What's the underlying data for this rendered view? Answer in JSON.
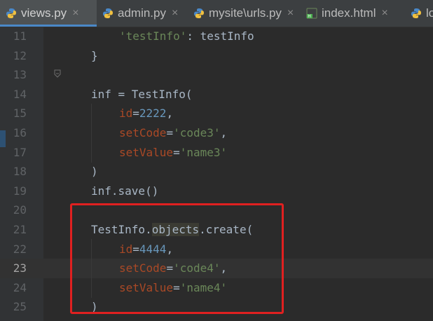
{
  "tabs": [
    {
      "label": "views.py",
      "close": "×"
    },
    {
      "label": "admin.py",
      "close": "×"
    },
    {
      "label": "mysite\\urls.py",
      "close": "×"
    },
    {
      "label": "index.html",
      "close": "×"
    },
    {
      "label": "lo"
    }
  ],
  "lines": [
    {
      "n": "11",
      "seg": [
        "'testInfo'",
        ": testInfo"
      ]
    },
    {
      "n": "12",
      "seg": [
        "}"
      ]
    },
    {
      "n": "13",
      "seg": []
    },
    {
      "n": "14",
      "seg": [
        "inf = TestInfo("
      ]
    },
    {
      "n": "15",
      "seg": [
        "id",
        "=",
        "2222",
        ","
      ]
    },
    {
      "n": "16",
      "seg": [
        "setCode",
        "=",
        "'code3'",
        ","
      ]
    },
    {
      "n": "17",
      "seg": [
        "setValue",
        "=",
        "'name3'"
      ]
    },
    {
      "n": "18",
      "seg": [
        ")"
      ]
    },
    {
      "n": "19",
      "seg": [
        "inf.save()"
      ]
    },
    {
      "n": "20",
      "seg": []
    },
    {
      "n": "21",
      "seg": [
        "TestInfo.",
        "objects",
        ".create("
      ]
    },
    {
      "n": "22",
      "seg": [
        "id",
        "=",
        "4444",
        ","
      ]
    },
    {
      "n": "23",
      "seg": [
        "setCode",
        "=",
        "'code4'",
        ","
      ]
    },
    {
      "n": "24",
      "seg": [
        "setValue",
        "=",
        "'name4'"
      ]
    },
    {
      "n": "25",
      "seg": [
        ")"
      ]
    }
  ],
  "current_line": "23",
  "colors": {
    "background": "#2b2b2b",
    "string": "#6a8759",
    "number": "#6897bb",
    "param": "#aa4926",
    "text": "#a9b7c6",
    "box": "#e02020"
  }
}
